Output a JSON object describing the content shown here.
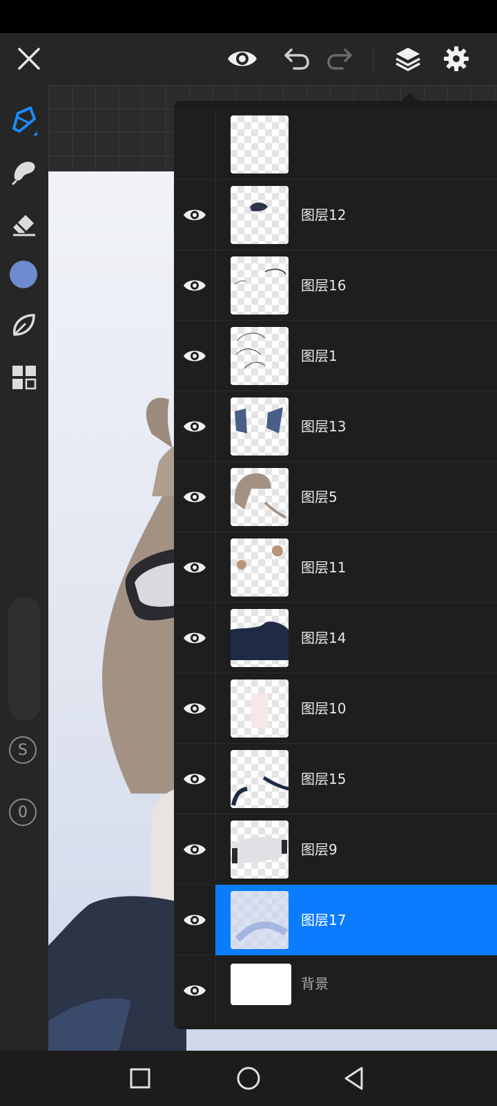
{
  "colors": {
    "accent": "#0a7cff",
    "brush_color": "#6f8bcf"
  },
  "toolbar": {
    "close_icon": "close-icon",
    "preview_icon": "eye-icon",
    "undo_icon": "undo-icon",
    "redo_icon": "redo-icon",
    "layers_icon": "layers-icon",
    "settings_icon": "gear-icon"
  },
  "sidebar": {
    "tools": [
      "pen-tool-icon",
      "smudge-tool-icon",
      "eraser-icon",
      "color-swatch",
      "leaf-brush-icon",
      "grid-menu-icon"
    ],
    "size_label": "S",
    "opacity_label": "0"
  },
  "layer_panel": {
    "actions": [
      "add-layer-icon",
      "folder-icon",
      "lock-icon",
      "merge-down-icon",
      "transparency-icon",
      "blend-icon"
    ],
    "layers": [
      {
        "name": "图层12",
        "visible": true,
        "selected": false
      },
      {
        "name": "图层16",
        "visible": true,
        "selected": false
      },
      {
        "name": "图层1",
        "visible": true,
        "selected": false
      },
      {
        "name": "图层13",
        "visible": true,
        "selected": false
      },
      {
        "name": "图层5",
        "visible": true,
        "selected": false
      },
      {
        "name": "图层11",
        "visible": true,
        "selected": false
      },
      {
        "name": "图层14",
        "visible": true,
        "selected": false
      },
      {
        "name": "图层10",
        "visible": true,
        "selected": false
      },
      {
        "name": "图层15",
        "visible": true,
        "selected": false
      },
      {
        "name": "图层9",
        "visible": true,
        "selected": false
      },
      {
        "name": "图层17",
        "visible": true,
        "selected": true
      },
      {
        "name": "背景",
        "visible": true,
        "selected": false
      }
    ]
  },
  "navbar": {
    "buttons": [
      "recent-apps-icon",
      "home-icon",
      "back-icon"
    ]
  }
}
